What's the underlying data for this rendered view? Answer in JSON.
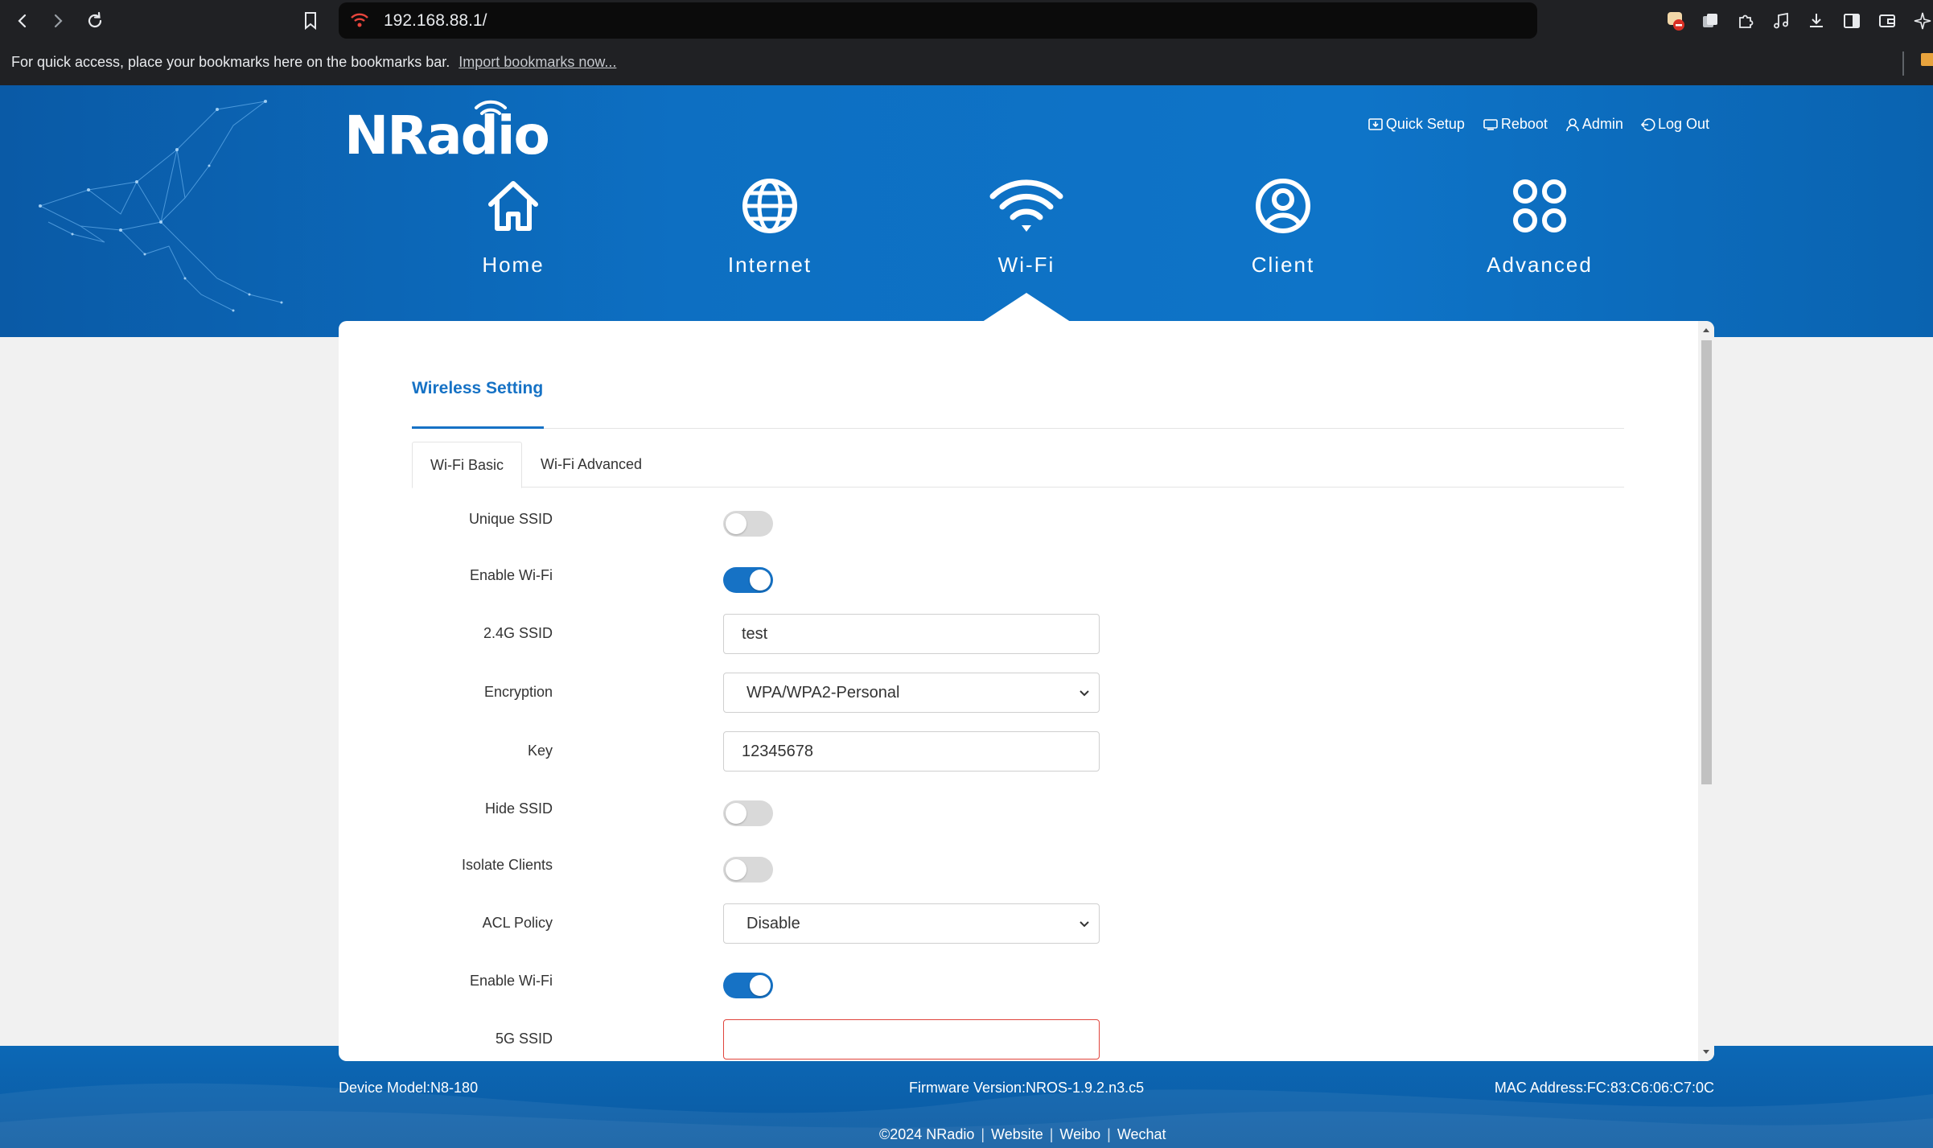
{
  "browser": {
    "url": "192.168.88.1/",
    "bookmarks_message": "For quick access, place your bookmarks here on the bookmarks bar.",
    "import_link": "Import bookmarks now..."
  },
  "header": {
    "logo": "NRadio",
    "top_links": [
      {
        "label": "Quick Setup",
        "icon": "quick-setup-icon"
      },
      {
        "label": "Reboot",
        "icon": "reboot-icon"
      },
      {
        "label": "Admin",
        "icon": "user-icon"
      },
      {
        "label": "Log Out",
        "icon": "logout-icon"
      }
    ],
    "menu": [
      {
        "label": "Home",
        "icon": "home-icon"
      },
      {
        "label": "Internet",
        "icon": "globe-icon"
      },
      {
        "label": "Wi-Fi",
        "icon": "wifi-icon",
        "active": true
      },
      {
        "label": "Client",
        "icon": "user-circle-icon"
      },
      {
        "label": "Advanced",
        "icon": "command-icon"
      }
    ]
  },
  "main": {
    "section_title": "Wireless Setting",
    "tabs": [
      {
        "label": "Wi-Fi Basic",
        "active": true
      },
      {
        "label": "Wi-Fi Advanced",
        "active": false
      }
    ],
    "form": {
      "unique_ssid": {
        "label": "Unique SSID",
        "enabled": false
      },
      "enable_wifi_24": {
        "label": "Enable Wi-Fi",
        "enabled": true
      },
      "ssid_24": {
        "label": "2.4G SSID",
        "value": "test"
      },
      "encryption": {
        "label": "Encryption",
        "value": "WPA/WPA2-Personal"
      },
      "key": {
        "label": "Key",
        "value": "12345678"
      },
      "hide_ssid": {
        "label": "Hide SSID",
        "enabled": false
      },
      "isolate_clients": {
        "label": "Isolate Clients",
        "enabled": false
      },
      "acl_policy": {
        "label": "ACL Policy",
        "value": "Disable"
      },
      "enable_wifi_5": {
        "label": "Enable Wi-Fi",
        "enabled": true
      },
      "ssid_5": {
        "label": "5G SSID",
        "value": ""
      }
    }
  },
  "footer": {
    "device_model": "Device Model:N8-180",
    "firmware": "Firmware Version:NROS-1.9.2.n3.c5",
    "mac": "MAC Address:FC:83:C6:06:C7:0C",
    "links": [
      "©2024 NRadio",
      "Website",
      "Weibo",
      "Wechat"
    ]
  },
  "colors": {
    "brand_blue": "#1672c5",
    "header_blue": "#0e74c8",
    "error_red": "#e0443c",
    "toggle_off": "#d9d9d9"
  }
}
